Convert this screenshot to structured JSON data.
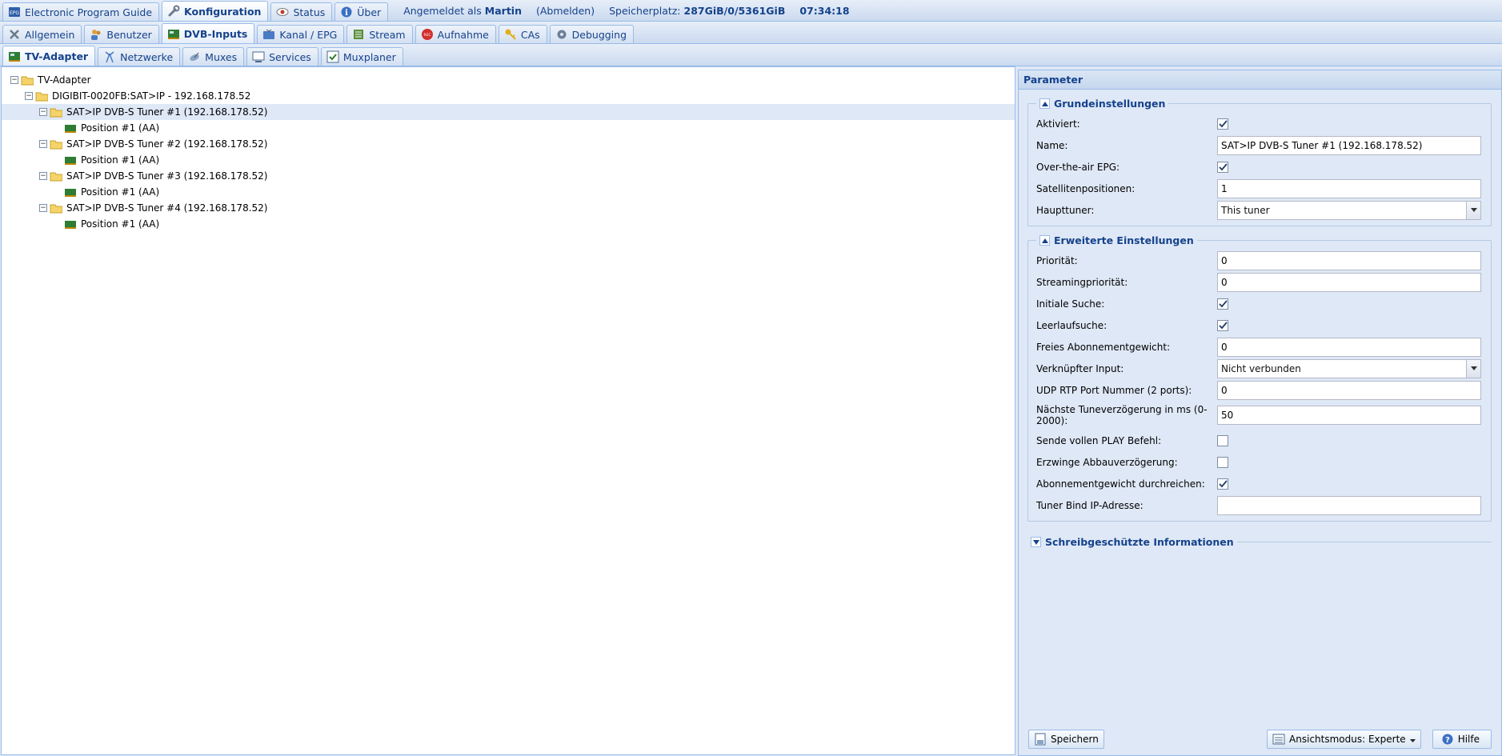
{
  "topbar": {
    "tabs": [
      {
        "label": "Electronic Program Guide",
        "icon": "epg-icon"
      },
      {
        "label": "Konfiguration",
        "icon": "wrench-icon"
      },
      {
        "label": "Status",
        "icon": "eye-icon"
      },
      {
        "label": "Über",
        "icon": "info-icon"
      }
    ],
    "logged_prefix": "Angemeldet als",
    "user": "Martin",
    "logout": "(Abmelden)",
    "storage_label": "Speicherplatz:",
    "storage_value": "287GiB/0/5361GiB",
    "time": "07:34:18"
  },
  "config_tabs": [
    {
      "label": "Allgemein",
      "icon": "tools-icon"
    },
    {
      "label": "Benutzer",
      "icon": "users-icon"
    },
    {
      "label": "DVB-Inputs",
      "icon": "card-icon"
    },
    {
      "label": "Kanal / EPG",
      "icon": "tv-icon"
    },
    {
      "label": "Stream",
      "icon": "stream-icon"
    },
    {
      "label": "Aufnahme",
      "icon": "record-icon"
    },
    {
      "label": "CAs",
      "icon": "key-icon"
    },
    {
      "label": "Debugging",
      "icon": "bug-icon"
    }
  ],
  "dvb_tabs": [
    {
      "label": "TV-Adapter",
      "icon": "card-icon"
    },
    {
      "label": "Netzwerke",
      "icon": "antenna-icon"
    },
    {
      "label": "Muxes",
      "icon": "satellite-icon"
    },
    {
      "label": "Services",
      "icon": "monitor-icon"
    },
    {
      "label": "Muxplaner",
      "icon": "check-icon"
    }
  ],
  "tree": {
    "root": "TV-Adapter",
    "device": "DIGIBIT-0020FB:SAT>IP - 192.168.178.52",
    "tuners": [
      {
        "label": "SAT>IP DVB-S Tuner #1 (192.168.178.52)",
        "child": "Position #1 (AA)"
      },
      {
        "label": "SAT>IP DVB-S Tuner #2 (192.168.178.52)",
        "child": "Position #1 (AA)"
      },
      {
        "label": "SAT>IP DVB-S Tuner #3 (192.168.178.52)",
        "child": "Position #1 (AA)"
      },
      {
        "label": "SAT>IP DVB-S Tuner #4 (192.168.178.52)",
        "child": "Position #1 (AA)"
      }
    ]
  },
  "params": {
    "title": "Parameter",
    "basic": {
      "legend": "Grundeinstellungen",
      "enabled_label": "Aktiviert:",
      "name_label": "Name:",
      "name_value": "SAT>IP DVB-S Tuner #1 (192.168.178.52)",
      "ota_epg_label": "Over-the-air EPG:",
      "satpos_label": "Satellitenpositionen:",
      "satpos_value": "1",
      "master_label": "Haupttuner:",
      "master_value": "This tuner"
    },
    "advanced": {
      "legend": "Erweiterte Einstellungen",
      "priority_label": "Priorität:",
      "priority_value": "0",
      "spriority_label": "Streamingpriorität:",
      "spriority_value": "0",
      "initscan_label": "Initiale Suche:",
      "idlescan_label": "Leerlaufsuche:",
      "freeweight_label": "Freies Abonnementgewicht:",
      "freeweight_value": "0",
      "linked_label": "Verknüpfter Input:",
      "linked_value": "Nicht verbunden",
      "udp_label": "UDP RTP Port Nummer (2 ports):",
      "udp_value": "0",
      "tunedelay_label": "Nächste Tuneverzögerung in ms (0-2000):",
      "tunedelay_value": "50",
      "fullplay_label": "Sende vollen PLAY Befehl:",
      "teardown_label": "Erzwinge Abbauverzögerung:",
      "passweight_label": "Abonnementgewicht durchreichen:",
      "bindip_label": "Tuner Bind IP-Adresse:",
      "bindip_value": ""
    },
    "readonly": {
      "legend": "Schreibgeschützte Informationen"
    },
    "checks": {
      "enabled": true,
      "ota_epg": true,
      "initscan": true,
      "idlescan": true,
      "fullplay": false,
      "teardown": false,
      "passweight": true
    }
  },
  "footer": {
    "save": "Speichern",
    "viewmode": "Ansichtsmodus: Experte",
    "help": "Hilfe"
  }
}
